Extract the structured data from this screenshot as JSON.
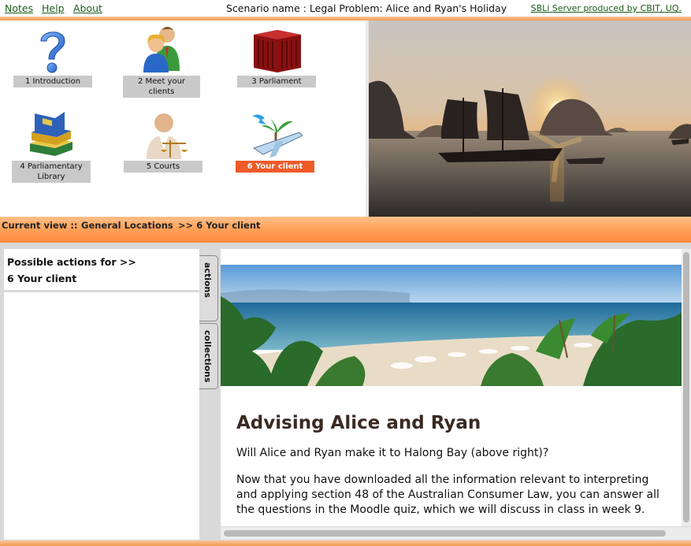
{
  "menu": {
    "notes": "Notes",
    "help": "Help",
    "about": "About"
  },
  "scenario_title": "Scenario name : Legal Problem: Alice and Ryan's Holiday",
  "server_link": "SBLi Server produced by CBIT, UQ.",
  "locations": [
    {
      "label": "1 Introduction",
      "icon": "question-mark-icon"
    },
    {
      "label": "2 Meet your clients",
      "icon": "people-icon"
    },
    {
      "label": "3 Parliament",
      "icon": "parliament-building-icon"
    },
    {
      "label": "4 Parliamentary Library",
      "icon": "books-icon"
    },
    {
      "label": "5 Courts",
      "icon": "judge-scales-icon"
    },
    {
      "label": "6 Your client",
      "icon": "airplane-palm-icon",
      "active": true
    }
  ],
  "current_view": {
    "prefix": "Current view ::",
    "crumb1": "General Locations",
    "crumb2": ">> 6 Your client"
  },
  "actions_panel": {
    "line1": "Possible actions for >>",
    "line2": "6 Your client"
  },
  "tabs": {
    "actions": "actions",
    "collections": "collections"
  },
  "content": {
    "heading": "Advising Alice and Ryan",
    "para1": "Will Alice and Ryan make it to Halong Bay (above right)?",
    "para2": "Now that you have downloaded all the information relevant to interpreting and applying section 48 of the Australian Consumer Law, you can answer all the questions in the Moodle quiz, which we will discuss in class in week 9."
  },
  "colors": {
    "accent_orange": "#ef5a28",
    "link_green": "#1a5e1a",
    "bar_orange": "#ff9a4d"
  }
}
